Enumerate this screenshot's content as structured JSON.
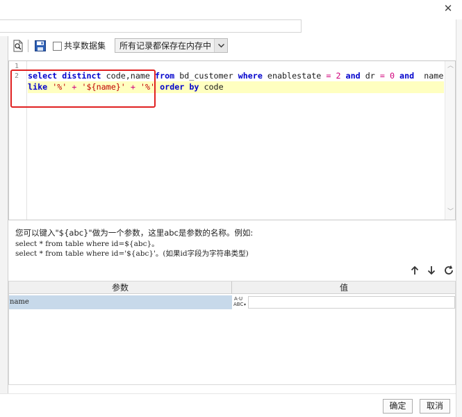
{
  "toolbar": {
    "shared_dataset_label": "共享数据集",
    "shared_dataset_checked": false,
    "storage_mode_value": "所有记录都保存在内存中"
  },
  "editor": {
    "line_numbers": [
      "1",
      "2"
    ],
    "code_line_1": [
      {
        "t": "kw",
        "v": "select"
      },
      {
        "t": "sp",
        "v": " "
      },
      {
        "t": "kw",
        "v": "distinct"
      },
      {
        "t": "sp",
        "v": " "
      },
      {
        "t": "id",
        "v": "code,name"
      },
      {
        "t": "sp",
        "v": " "
      },
      {
        "t": "kw",
        "v": "from"
      },
      {
        "t": "sp",
        "v": " "
      },
      {
        "t": "id",
        "v": "bd_customer"
      },
      {
        "t": "sp",
        "v": " "
      },
      {
        "t": "kw",
        "v": "where"
      },
      {
        "t": "sp",
        "v": " "
      },
      {
        "t": "id",
        "v": "enablestate"
      },
      {
        "t": "sp",
        "v": " "
      },
      {
        "t": "op",
        "v": "="
      },
      {
        "t": "sp",
        "v": " "
      },
      {
        "t": "op",
        "v": "2"
      },
      {
        "t": "sp",
        "v": " "
      },
      {
        "t": "kw",
        "v": "and"
      },
      {
        "t": "sp",
        "v": " "
      },
      {
        "t": "id",
        "v": "dr"
      },
      {
        "t": "sp",
        "v": " "
      },
      {
        "t": "op",
        "v": "="
      },
      {
        "t": "sp",
        "v": " "
      },
      {
        "t": "op",
        "v": "0"
      },
      {
        "t": "sp",
        "v": " "
      },
      {
        "t": "kw",
        "v": "and"
      },
      {
        "t": "sp",
        "v": "  "
      },
      {
        "t": "id",
        "v": "name"
      }
    ],
    "code_line_2": [
      {
        "t": "kw",
        "v": "like"
      },
      {
        "t": "sp",
        "v": " "
      },
      {
        "t": "str",
        "v": "'%'"
      },
      {
        "t": "sp",
        "v": " "
      },
      {
        "t": "op",
        "v": "+"
      },
      {
        "t": "sp",
        "v": " "
      },
      {
        "t": "str",
        "v": "'${name}'"
      },
      {
        "t": "sp",
        "v": " "
      },
      {
        "t": "op",
        "v": "+"
      },
      {
        "t": "sp",
        "v": " "
      },
      {
        "t": "str",
        "v": "'%'"
      },
      {
        "t": "sp",
        "v": " "
      },
      {
        "t": "kw",
        "v": "order"
      },
      {
        "t": "sp",
        "v": " "
      },
      {
        "t": "kw",
        "v": "by"
      },
      {
        "t": "sp",
        "v": " "
      },
      {
        "t": "id",
        "v": "code"
      }
    ]
  },
  "help": {
    "lines": [
      "您可以键入\"${abc}\"做为一个参数，这里abc是参数的名称。例如:",
      "select * from table where id=${abc}。",
      "select * from table where id='${abc}'。(如果id字段为字符串类型)"
    ]
  },
  "params": {
    "headers": {
      "param": "参数",
      "value": "值"
    },
    "rows": [
      {
        "name": "name",
        "value": "",
        "type_icon_text": "ABC"
      }
    ]
  },
  "footer": {
    "ok_label": "确定",
    "cancel_label": "取消"
  },
  "icons": {
    "close": "close-icon",
    "preview": "preview-icon",
    "save": "save-icon",
    "dropdown": "chevron-down-icon",
    "up": "arrow-up-icon",
    "down": "arrow-down-icon",
    "refresh": "refresh-icon"
  },
  "colors": {
    "keyword": "#0000cc",
    "string": "#c00000",
    "operator": "#d0007a",
    "current_line": "#ffffc0",
    "annotation": "#e02020",
    "selected_row": "#c7d9ea"
  }
}
